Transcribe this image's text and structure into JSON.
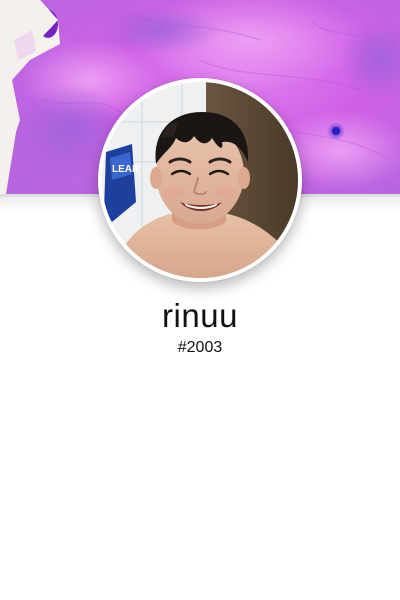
{
  "profile": {
    "username": "rinuu",
    "tag": "#2003"
  },
  "banner": {
    "icon": "watercolor-banner",
    "colors": [
      "#c84be0",
      "#e28cf0",
      "#a96fd6",
      "#8a4fd0",
      "#f4f1ec"
    ]
  },
  "avatar": {
    "icon": "profile-photo"
  }
}
